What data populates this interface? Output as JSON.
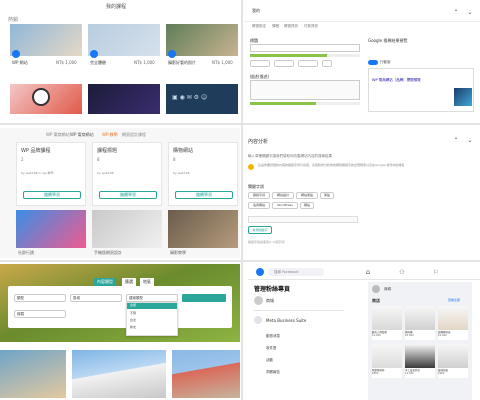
{
  "colors": {
    "accent_teal": "#2aa69a",
    "blue": "#1877f2",
    "orange": "#f37021",
    "green": "#8bc34a"
  },
  "p1": {
    "title": "我的課程",
    "section_label": "熱銷",
    "cards": [
      {
        "name": "WP 網站",
        "price": "NT$ 1,000"
      },
      {
        "name": "完全體驗",
        "price": "NT$ 1,000"
      },
      {
        "name": "攝影好看的照片",
        "price": "NT$ 1,000"
      }
    ]
  },
  "p2": {
    "tab_active": "我的",
    "tabs": [
      "帳號設定",
      "課程",
      "帳號資訊",
      "付款資訊"
    ],
    "field_title_label": "標題",
    "field_desc_label": "描述(描述)",
    "google_title": "Google 搜尋結果預覽",
    "google_toggle_label": "行動版",
    "preview_label": "WP 電商網站（品牌）標題預覽"
  },
  "p3": {
    "tabs": [
      "WP 電商網站",
      "WP 電商網站",
      "WP 教學",
      "網頁設計課程"
    ],
    "cards": [
      {
        "title": "WP 品牌課程",
        "stat": "2",
        "note": "by web168 in wp 教學"
      },
      {
        "title": "課程標題",
        "stat": "8",
        "note": "by web168"
      },
      {
        "title": "購物網站",
        "stat": "8",
        "note": "by web168"
      }
    ],
    "btn_label": "繼續學習",
    "bottom": [
      "社群行銷",
      "手機版網頁設計",
      "攝影教學"
    ]
  },
  "p4": {
    "title": "內容分析",
    "subtitle": "輸入準確關鍵字讓我們幫助你改善網站內容的搜尋結果",
    "info_text": "這是你要評價的內容的關鍵字評分系統，系統將會分析你的網頁關鍵字的出現頻率以及在Google 搜尋中的排名",
    "keywords_label": "關鍵字詞",
    "tags": [
      "關鍵字詞",
      "網站設計",
      "網站架設",
      "架設",
      "電商網站",
      "WordPress",
      "網站"
    ],
    "add_btn": "新增關鍵字",
    "note": "關鍵字建議使用2~5個字詞"
  },
  "p5": {
    "tab1": "內容類型",
    "tab2": "篩選",
    "tab3": "地區",
    "selects": [
      "類型",
      "區域",
      "建案類型",
      "總價"
    ],
    "dropdown_items": [
      "全部",
      "不限",
      "台北",
      "新北"
    ]
  },
  "p6": {
    "search_placeholder": "搜尋 Facebook",
    "title": "管理粉絲專頁",
    "page_name": "商城",
    "suite": "Meta Business Suite",
    "menu": [
      "動態消息",
      "收件匣",
      "活動",
      "洞察報告"
    ],
    "shop_label": "商店",
    "products": [
      {
        "name": "麵包刀具套組",
        "price": "$1,200"
      },
      {
        "name": "咖啡機",
        "price": "$3,600"
      },
      {
        "name": "旋轉咖啡壺",
        "price": "$2,400"
      },
      {
        "name": "陶瓷咖啡杯",
        "price": "$800"
      },
      {
        "name": "手工皮革錢包",
        "price": "$1,500"
      },
      {
        "name": "玻璃花瓶",
        "price": "$900"
      }
    ],
    "see_all": "查看全部"
  }
}
